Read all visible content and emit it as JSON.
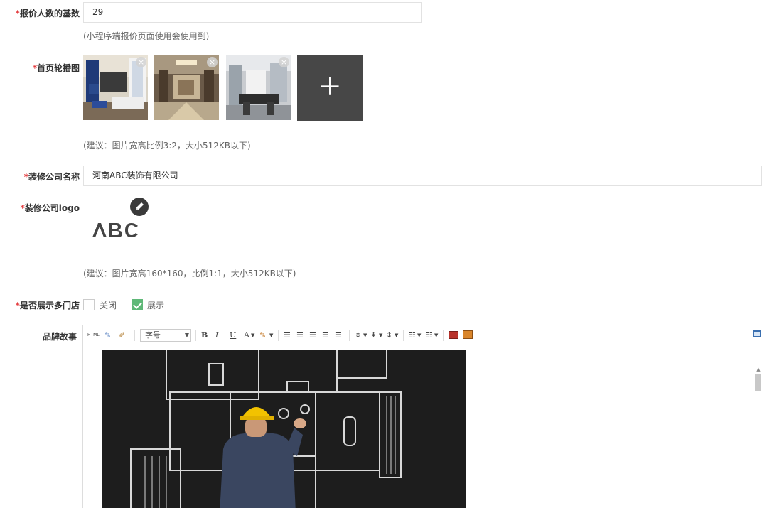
{
  "fields": {
    "base_count": {
      "label": "报价人数的基数",
      "value": "29",
      "hint": "(小程序端报价页面使用会使用到)"
    },
    "carousel": {
      "label": "首页轮播图",
      "close_glyph": "×",
      "add_glyph": "+",
      "hint": "(建议：图片宽高比例3:2，大小512KB以下)"
    },
    "company_name": {
      "label": "装修公司名称",
      "value": "河南ABC装饰有限公司"
    },
    "company_logo": {
      "label": "装修公司logo",
      "logo_text": "ABC",
      "hint": "(建议：图片宽高160*160，比例1:1，大小512KB以下)"
    },
    "multi_store": {
      "label": "是否展示多门店",
      "option_close": "关闭",
      "option_show": "展示"
    },
    "brand_story": {
      "label": "品牌故事"
    }
  },
  "required_mark": "*",
  "editor_toolbar": {
    "html": "HTML",
    "font_size": "字号",
    "bold": "B",
    "italic": "I",
    "underline": "U",
    "font_color": "A"
  },
  "colors": {
    "required": "#e4393c",
    "checked": "#5fb878",
    "add_tile": "#474747"
  }
}
